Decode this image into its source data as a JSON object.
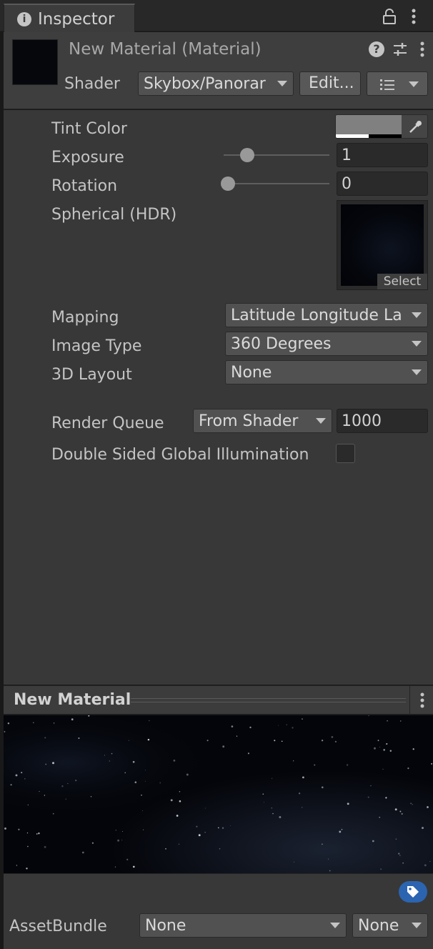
{
  "tab": {
    "label": "Inspector"
  },
  "header": {
    "title": "New Material (Material)",
    "shader_label": "Shader",
    "shader_value": "Skybox/Panorar",
    "edit_label": "Edit..."
  },
  "properties": {
    "tint_color": {
      "label": "Tint Color",
      "color": "#808080"
    },
    "exposure": {
      "label": "Exposure",
      "value": "1",
      "slider_fraction": 0.18
    },
    "rotation": {
      "label": "Rotation",
      "value": "0",
      "slider_fraction": 0.0
    },
    "spherical": {
      "label": "Spherical  (HDR)",
      "select_label": "Select"
    },
    "mapping": {
      "label": "Mapping",
      "value": "Latitude Longitude La"
    },
    "image_type": {
      "label": "Image Type",
      "value": "360 Degrees"
    },
    "layout_3d": {
      "label": "3D Layout",
      "value": "None"
    },
    "render_queue": {
      "label": "Render Queue",
      "mode": "From Shader",
      "value": "1000"
    },
    "double_sided_gi": {
      "label": "Double Sided Global Illumination",
      "checked": false
    }
  },
  "preview": {
    "title": "New Material"
  },
  "footer": {
    "assetbundle_label": "AssetBundle",
    "bundle_value": "None",
    "variant_value": "None",
    "tag_color": "#2b64b0"
  },
  "colors": {
    "panel": "#383838",
    "header": "#3e3e3e",
    "field": "#2a2a2a",
    "dropdown": "#515151"
  },
  "icons": [
    "info-icon",
    "lock-icon",
    "kebab-icon",
    "help-icon",
    "sliders-icon",
    "eyedropper-icon",
    "list-icon",
    "tag-icon"
  ]
}
